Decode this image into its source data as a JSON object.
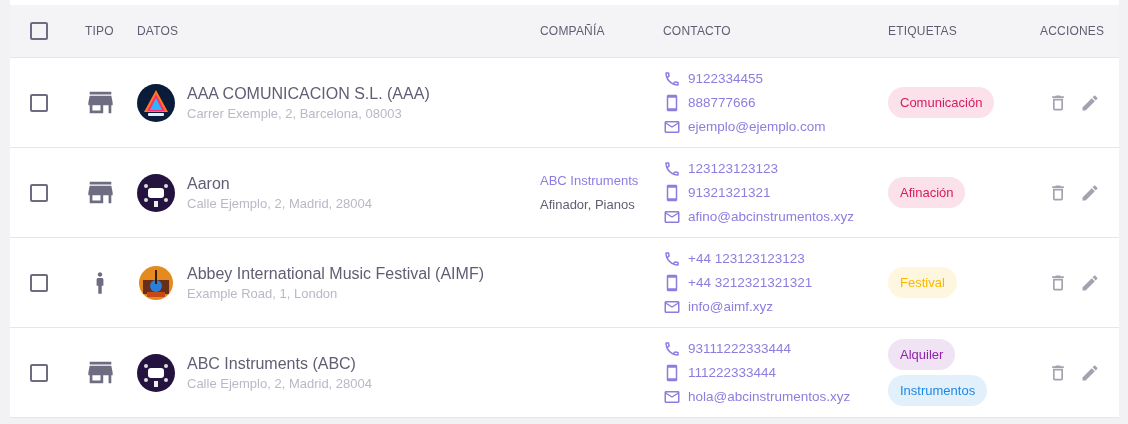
{
  "table": {
    "select_all": {
      "checked": false
    },
    "columns": [
      "TIPO",
      "DATOS",
      "COMPAÑÍA",
      "CONTACTO",
      "ETIQUETAS",
      "ACCIONES"
    ],
    "rows": [
      {
        "checked": false,
        "kind": "business",
        "avatar": {
          "kind": "picture"
        },
        "name": "AAA COMUNICACION S.L. (AAA)",
        "address": "Carrer Exemple, 2, Barcelona, 08003",
        "contacts": [
          {
            "kind": "phone",
            "value": "9122334455"
          },
          {
            "kind": "mobile",
            "value": "888777666"
          },
          {
            "kind": "email",
            "value": "ejemplo@ejemplo.com"
          }
        ],
        "tags": [
          {
            "label": "Comunicación",
            "color": "#d81b60"
          }
        ]
      },
      {
        "checked": false,
        "kind": "business",
        "avatar": {
          "kind": "picture"
        },
        "name": "Aaron",
        "address": "Calle Ejemplo, 2, Madrid, 28004",
        "company": {
          "name": "ABC Instruments",
          "roles": "Afinador, Pianos"
        },
        "contacts": [
          {
            "kind": "phone",
            "value": "123123123123"
          },
          {
            "kind": "mobile",
            "value": "91321321321"
          },
          {
            "kind": "email",
            "value": "afino@abcinstrumentos.xyz"
          }
        ],
        "tags": [
          {
            "label": "Afinación",
            "color": "#d81b60"
          }
        ]
      },
      {
        "checked": false,
        "kind": "person",
        "avatar": {
          "kind": "picture"
        },
        "name": "Abbey International Music Festival (AIMF)",
        "address": "Example Road, 1, London",
        "contacts": [
          {
            "kind": "phone",
            "value": "+44 123123123123"
          },
          {
            "kind": "mobile",
            "value": "+44 3212321321321"
          },
          {
            "kind": "email",
            "value": "info@aimf.xyz"
          }
        ],
        "tags": [
          {
            "label": "Festival",
            "color": "#f9b800"
          }
        ]
      },
      {
        "checked": false,
        "kind": "business",
        "avatar": {
          "kind": "picture"
        },
        "name": "ABC Instruments (ABC)",
        "address": "Calle Ejemplo, 2, Madrid, 28004",
        "contacts": [
          {
            "kind": "phone",
            "value": "93111222333444"
          },
          {
            "kind": "mobile",
            "value": "111222333444"
          },
          {
            "kind": "email",
            "value": "hola@abcinstrumentos.xyz"
          }
        ],
        "tags": [
          {
            "label": "Alquiler",
            "color": "#8e24aa"
          },
          {
            "label": "Instrumentos",
            "color": "#1e88e5"
          }
        ]
      }
    ]
  }
}
